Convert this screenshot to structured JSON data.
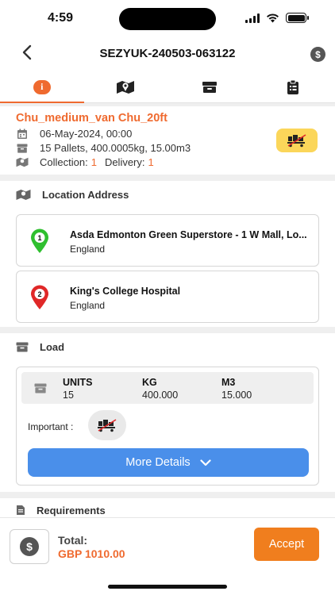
{
  "status": {
    "time": "4:59"
  },
  "header": {
    "title": "SEZYUK-240503-063122",
    "back_icon": "chevron-left-icon",
    "dollar_icon": "dollar-icon"
  },
  "tabs": [
    {
      "name": "info",
      "icon": "info-icon",
      "label": "i",
      "active": true
    },
    {
      "name": "map",
      "icon": "map-icon"
    },
    {
      "name": "box",
      "icon": "box-icon"
    },
    {
      "name": "checklist",
      "icon": "clipboard-icon"
    }
  ],
  "summary": {
    "vehicle": "Chu_medium_van Chu_20ft",
    "date": "06-May-2024, 00:00",
    "load": "15 Pallets, 400.0005kg, 15.00m3",
    "collection_label": "Collection:",
    "collection_count": "1",
    "delivery_label": "Delivery:",
    "delivery_count": "1",
    "accent_color": "#ef6a2f"
  },
  "location": {
    "heading": "Location Address",
    "stops": [
      {
        "number": "1",
        "name": "Asda Edmonton Green Superstore - 1 W Mall, Lo...",
        "country": "England",
        "color": "#2fbf2f"
      },
      {
        "number": "2",
        "name": "King's College Hospital",
        "country": "England",
        "color": "#e02828"
      }
    ]
  },
  "load": {
    "heading": "Load",
    "units_label": "UNITS",
    "units_value": "15",
    "kg_label": "KG",
    "kg_value": "400.000",
    "m3_label": "M3",
    "m3_value": "15.000",
    "important_label": "Important :",
    "more_details": "More Details"
  },
  "requirements": {
    "heading": "Requirements"
  },
  "footer": {
    "total_label": "Total:",
    "total_value": "GBP 1010.00",
    "accept_label": "Accept",
    "currency_symbol": "$"
  }
}
